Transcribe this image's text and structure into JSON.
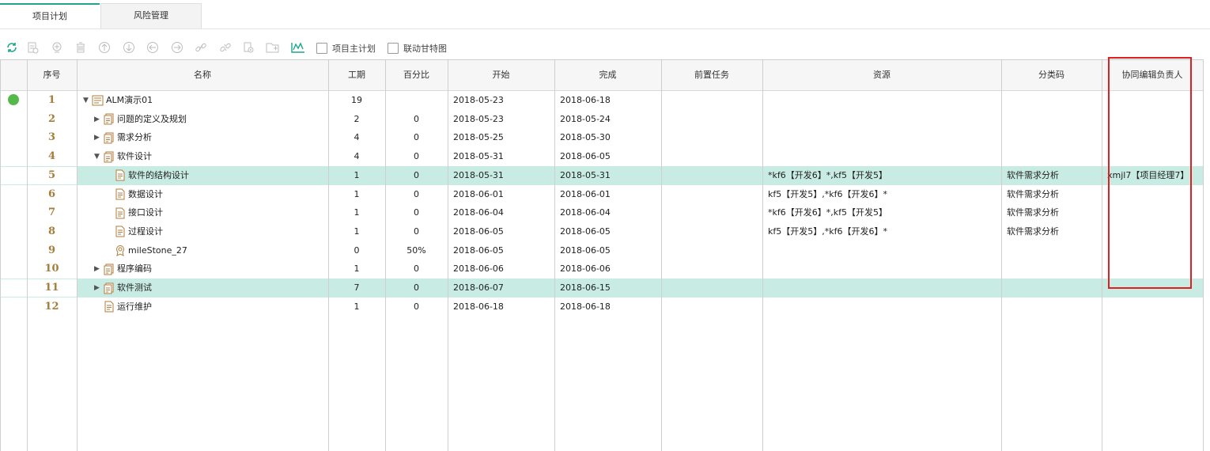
{
  "tabs": [
    {
      "label": "项目计划",
      "active": true
    },
    {
      "label": "风险管理",
      "active": false
    }
  ],
  "toolbar": {
    "icons": [
      "refresh-icon",
      "add-task-icon",
      "add-subtask-icon",
      "delete-icon",
      "move-up-icon",
      "move-down-icon",
      "outdent-icon",
      "indent-icon",
      "link-icon",
      "unlink-icon",
      "settings-icon",
      "folder-icon",
      "gantt-icon"
    ],
    "check_master_plan": "项目主计划",
    "check_linked_gantt": "联动甘特图"
  },
  "columns": {
    "seq": "序号",
    "name": "名称",
    "duration": "工期",
    "percent": "百分比",
    "start": "开始",
    "finish": "完成",
    "predecessor": "前置任务",
    "resource": "资源",
    "category": "分类码",
    "coeditor": "协同编辑负责人"
  },
  "rows": [
    {
      "seq": "1",
      "name": "ALM演示01",
      "level": 0,
      "toggle": "▼",
      "icon": "project-icon",
      "duration": "19",
      "percent": "",
      "start": "2018-05-23",
      "finish": "2018-06-18",
      "predecessor": "",
      "resource": "",
      "category": "",
      "coeditor": "",
      "status": "green"
    },
    {
      "seq": "2",
      "name": "问题的定义及规划",
      "level": 1,
      "toggle": "▶",
      "icon": "summary-task-icon",
      "duration": "2",
      "percent": "0",
      "start": "2018-05-23",
      "finish": "2018-05-24",
      "predecessor": "",
      "resource": "",
      "category": "",
      "coeditor": ""
    },
    {
      "seq": "3",
      "name": "需求分析",
      "level": 1,
      "toggle": "▶",
      "icon": "summary-task-icon",
      "duration": "4",
      "percent": "0",
      "start": "2018-05-25",
      "finish": "2018-05-30",
      "predecessor": "",
      "resource": "",
      "category": "",
      "coeditor": ""
    },
    {
      "seq": "4",
      "name": "软件设计",
      "level": 1,
      "toggle": "▼",
      "icon": "summary-task-icon",
      "duration": "4",
      "percent": "0",
      "start": "2018-05-31",
      "finish": "2018-06-05",
      "predecessor": "",
      "resource": "",
      "category": "",
      "coeditor": ""
    },
    {
      "seq": "5",
      "name": "软件的结构设计",
      "level": 2,
      "toggle": "",
      "icon": "task-icon",
      "duration": "1",
      "percent": "0",
      "start": "2018-05-31",
      "finish": "2018-05-31",
      "predecessor": "",
      "resource": "*kf6【开发6】*,kf5【开发5】",
      "category": "软件需求分析",
      "coeditor": "xmjl7【项目经理7】",
      "highlight": true
    },
    {
      "seq": "6",
      "name": "数据设计",
      "level": 2,
      "toggle": "",
      "icon": "task-icon",
      "duration": "1",
      "percent": "0",
      "start": "2018-06-01",
      "finish": "2018-06-01",
      "predecessor": "",
      "resource": "kf5【开发5】,*kf6【开发6】*",
      "category": "软件需求分析",
      "coeditor": ""
    },
    {
      "seq": "7",
      "name": "接口设计",
      "level": 2,
      "toggle": "",
      "icon": "task-icon",
      "duration": "1",
      "percent": "0",
      "start": "2018-06-04",
      "finish": "2018-06-04",
      "predecessor": "",
      "resource": "*kf6【开发6】*,kf5【开发5】",
      "category": "软件需求分析",
      "coeditor": ""
    },
    {
      "seq": "8",
      "name": "过程设计",
      "level": 2,
      "toggle": "",
      "icon": "task-icon",
      "duration": "1",
      "percent": "0",
      "start": "2018-06-05",
      "finish": "2018-06-05",
      "predecessor": "",
      "resource": "kf5【开发5】,*kf6【开发6】*",
      "category": "软件需求分析",
      "coeditor": ""
    },
    {
      "seq": "9",
      "name": "mileStone_27",
      "level": 2,
      "toggle": "",
      "icon": "milestone-icon",
      "duration": "0",
      "percent": "50%",
      "start": "2018-06-05",
      "finish": "2018-06-05",
      "predecessor": "",
      "resource": "",
      "category": "",
      "coeditor": ""
    },
    {
      "seq": "10",
      "name": "程序编码",
      "level": 1,
      "toggle": "▶",
      "icon": "summary-task-icon",
      "duration": "1",
      "percent": "0",
      "start": "2018-06-06",
      "finish": "2018-06-06",
      "predecessor": "",
      "resource": "",
      "category": "",
      "coeditor": ""
    },
    {
      "seq": "11",
      "name": "软件测试",
      "level": 1,
      "toggle": "▶",
      "icon": "summary-task-icon",
      "duration": "7",
      "percent": "0",
      "start": "2018-06-07",
      "finish": "2018-06-15",
      "predecessor": "",
      "resource": "",
      "category": "",
      "coeditor": "",
      "highlight": true
    },
    {
      "seq": "12",
      "name": "运行维护",
      "level": 1,
      "toggle": "",
      "icon": "task-icon",
      "duration": "1",
      "percent": "0",
      "start": "2018-06-18",
      "finish": "2018-06-18",
      "predecessor": "",
      "resource": "",
      "category": "",
      "coeditor": ""
    }
  ],
  "colors": {
    "accent": "#1fa58b",
    "highlight": "#c8ece3",
    "seq_text": "#a77d3a",
    "status_green": "#54b94a",
    "annotation_red": "#e02020"
  }
}
